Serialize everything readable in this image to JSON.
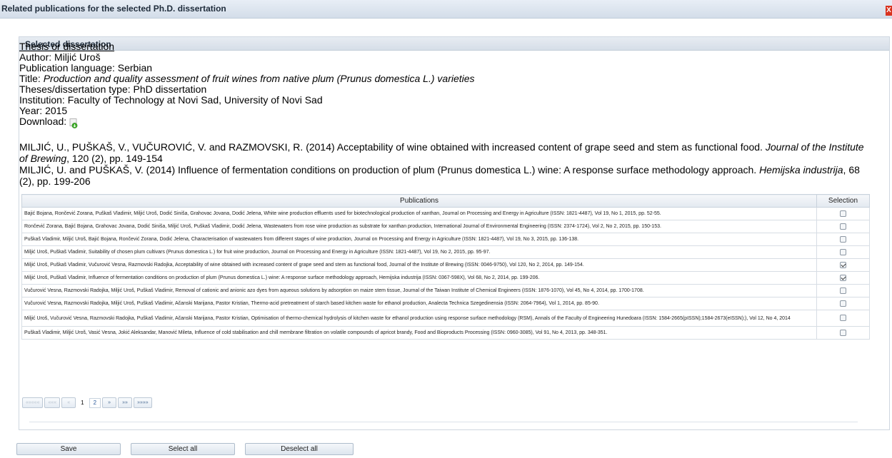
{
  "dialog": {
    "title": "Related publications for the selected Ph.D. dissertation",
    "close_glyph": "X"
  },
  "panel": {
    "title": "Selected dissertation"
  },
  "dissertation": {
    "type_link": "Thesis or dissertation",
    "author": "Author: Miljić Uroš",
    "language": "Publication language: Serbian",
    "title_label": "Title: ",
    "title_value": "Production and quality assessment of fruit wines from native plum (Prunus domestica L.) varieties",
    "type": "Theses/dissertation type: PhD dissertation",
    "institution": "Institution: Faculty of Technology at Novi Sad, University of Novi Sad",
    "year": "Year: 2015",
    "download_label": "Download:",
    "download_icon": "download-icon"
  },
  "references": [
    {
      "before": "MILJIĆ, U., PUŠKAŠ, V., VUČUROVIĆ, V. and RAZMOVSKI, R. (2014) Acceptability of wine obtained with increased content of grape seed and stem as functional food. ",
      "journal": "Journal of the Institute of Brewing",
      "after": ", 120 (2), pp. 149-154"
    },
    {
      "before": "MILJIĆ, U. and PUŠKAŠ, V. (2014) Influence of fermentation conditions on production of plum (Prunus domestica L.) wine: A response surface methodology approach. ",
      "journal": "Hemijska industrija",
      "after": ", 68 (2), pp. 199-206"
    }
  ],
  "table": {
    "col_publications": "Publications",
    "col_selection": "Selection",
    "rows": [
      {
        "text": "Bajić Bojana, Rončević Zorana, Puškaš Vladimir, Miljić Uroš, Dodić Siniša, Grahovac Jovana, Dodić Jelena, White wine production effluents used for biotechnological production of xanthan, Journal on Processing and Energy in Agriculture (ISSN: 1821-4487), Vol 19, No 1, 2015, pp. 52-55.",
        "checked": false
      },
      {
        "text": "Rončević Zorana, Bajić Bojana, Grahovac Jovana, Dodić Siniša, Miljić Uroš, Puškaš Vladimir, Dodić Jelena, Wastewaters from rose wine production as substrate for xanthan production, International Journal of Environmental Engineering (ISSN: 2374-1724), Vol 2, No 2, 2015, pp. 150-153.",
        "checked": false
      },
      {
        "text": "Puškaš Vladimir, Miljić Uroš, Bajić Bojana, Rončević Zorana, Dodić Jelena, Characterisation of wastewaters from different stages of wine production, Journal on Processing and Energy in Agriculture (ISSN: 1821-4487), Vol 19, No 3, 2015, pp. 136-138.",
        "checked": false
      },
      {
        "text": "Miljić Uroš, Puškaš Vladimir, Suitability of chosen plum cultivars (Prunus domestica L.) for fruit wine production, Journal on Processing and Energy in Agriculture (ISSN: 1821-4487), Vol 19, No 2, 2015, pp. 95-97.",
        "checked": false
      },
      {
        "text": "Miljić Uroš, Puškaš Vladimir, Vučurović Vesna, Razmovski Radojka, Acceptability of wine obtained with increased content of grape seed and stem as functional food, Journal of the Institute of Brewing (ISSN: 0046-9750), Vol 120, No 2, 2014, pp. 149-154.",
        "checked": true
      },
      {
        "text": "Miljić Uroš, Puškaš Vladimir, Influence of fermentation conditions on production of plum (Prunus domestica L.) wine: A response surface methodology approach, Hemijska industrija (ISSN: 0367-598X), Vol 68, No 2, 2014, pp. 199-206.",
        "checked": true
      },
      {
        "text": "Vučurović Vesna, Razmovski Radojka, Miljić Uroš, Puškaš Vladimir, Removal of cationic and anionic azo dyes from aqueous solutions by adsorption on maize stem tissue, Journal of the Taiwan Institute of Chemical Engineers (ISSN: 1876-1070), Vol 45, No 4, 2014, pp. 1700-1708.",
        "checked": false
      },
      {
        "text": "Vučurović Vesna, Razmovski Radojka, Miljić Uroš, Puškaš Vladimir, Ačanski Marijana, Pastor Kristian, Thermo-acid pretreatment of starch based kitchen waste for ethanol production, Analecta Technica Szegedinensia (ISSN: 2064-7964), Vol 1, 2014, pp. 85-90.",
        "checked": false
      },
      {
        "text": "Miljić Uroš, Vučurović Vesna, Razmovski Radojka, Puškaš Vladimir, Ačanski Marijana, Pastor Kristian, Optimisation of thermo-chemical hydrolysis of kitchen waste for ethanol production using response surface methodology (RSM), Annals of the Faculty of Engineering Hunedoara (ISSN: 1584-2665(pISSN);1584-2673(eISSN);), Vol 12, No 4, 2014",
        "checked": false
      },
      {
        "text": "Puškaš Vladimir, Miljić Uroš, Vasić Vesna, Jokić Aleksandar, Manović Mileta, Influence of cold stabilisation and chill membrane filtration on volatile compounds of apricot brandy, Food and Bioproducts Processing (ISSN: 0960-3085), Vol 91, No 4, 2013, pp. 348-351.",
        "checked": false
      }
    ]
  },
  "pager": {
    "first": "«««««",
    "prev_many": "«««",
    "prev": "«",
    "page1": "1",
    "page2": "2",
    "next": "»",
    "next_many": "»»",
    "last": "»»»»"
  },
  "buttons": {
    "save": "Save",
    "select_all": "Select all",
    "deselect_all": "Deselect all"
  }
}
